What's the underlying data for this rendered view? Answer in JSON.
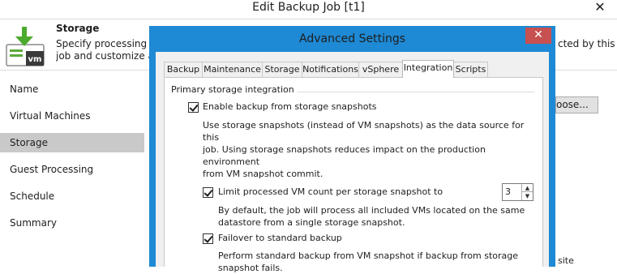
{
  "parent": {
    "title": "Edit Backup Job [t1]",
    "close_glyph": "✕",
    "header": {
      "icon": "vm-storage-icon",
      "title": "Storage",
      "desc_line1": "Specify processing pro",
      "desc_line2": "job and customize adv",
      "desc_right": "cted by this"
    },
    "nav": [
      {
        "label": "Name"
      },
      {
        "label": "Virtual Machines"
      },
      {
        "label": "Storage",
        "active": true
      },
      {
        "label": "Guest Processing"
      },
      {
        "label": "Schedule"
      },
      {
        "label": "Summary"
      }
    ],
    "choose_button_fragment": "oose...",
    "bottom_fragment": "site"
  },
  "dialog": {
    "title": "Advanced Settings",
    "close_glyph": "✕",
    "tabs": [
      {
        "label": "Backup"
      },
      {
        "label": "Maintenance"
      },
      {
        "label": "Storage"
      },
      {
        "label": "Notifications"
      },
      {
        "label": "vSphere"
      },
      {
        "label": "Integration",
        "active": true
      },
      {
        "label": "Scripts"
      }
    ],
    "group_title": "Primary storage integration",
    "enable_snapshots": {
      "checked": true,
      "label": "Enable backup from storage snapshots",
      "desc_line1": "Use storage snapshots (instead of VM snapshots) as the data source for this",
      "desc_line2": "job. Using storage snapshots reduces impact on the production environment",
      "desc_line3": "from VM snapshot commit."
    },
    "limit_vm_count": {
      "checked": true,
      "label": "Limit processed VM count per storage snapshot to",
      "value": "3",
      "desc_line1": "By default, the job will process all included VMs located on the same",
      "desc_line2": "datastore from a single storage snapshot."
    },
    "failover": {
      "checked": true,
      "label": "Failover to standard backup",
      "desc_line1": "Perform standard backup from VM snapshot if backup from storage",
      "desc_line2": "snapshot fails."
    }
  },
  "colors": {
    "dialog_frame": "#1e89d4",
    "close_button": "#c75050",
    "nav_active": "#c9c9c9"
  }
}
